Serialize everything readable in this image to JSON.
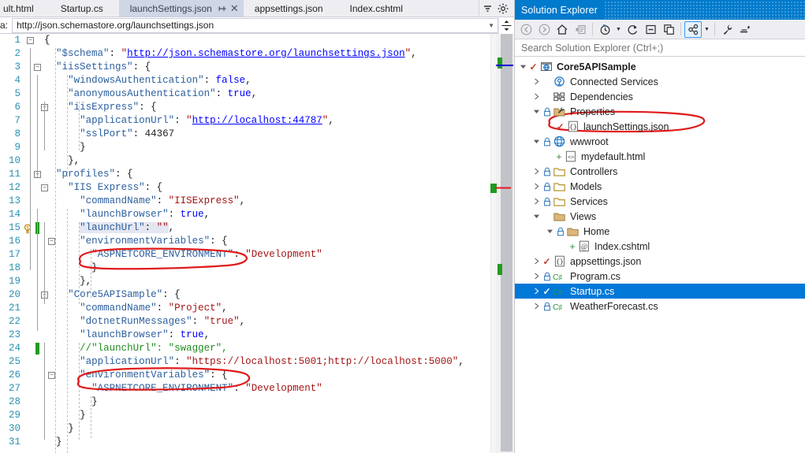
{
  "editor": {
    "tabs": [
      {
        "label": "ult.html",
        "state": "partial",
        "active": false
      },
      {
        "label": "Startup.cs",
        "state": "normal",
        "active": false
      },
      {
        "label": "launchSettings.json",
        "state": "normal",
        "active": true
      },
      {
        "label": "appsettings.json",
        "state": "normal",
        "active": false
      },
      {
        "label": "Index.cshtml",
        "state": "normal",
        "active": false
      }
    ],
    "tab_pin_icon": "pin-icon",
    "tab_close_icon": "close-icon",
    "tabstrip_overflow_icon": "chevron-down-icon",
    "tabstrip_settings_icon": "gear-icon",
    "nav": {
      "label": "a:",
      "value": "http://json.schemastore.org/launchsettings.json",
      "dropdown_icon": "chevron-down-icon",
      "split_icon": "split-view-icon"
    },
    "lines": [
      {
        "n": 1,
        "indent": 0,
        "outline": true,
        "text": "{"
      },
      {
        "n": 2,
        "indent": 1,
        "outline": false,
        "tokens": [
          {
            "t": "\"$schema\"",
            "c": "key"
          },
          {
            "t": ": ",
            "c": "punc"
          },
          {
            "t": "\"",
            "c": "str"
          },
          {
            "t": "http://json.schemastore.org/launchsettings.json",
            "c": "url"
          },
          {
            "t": "\"",
            "c": "str"
          },
          {
            "t": ",",
            "c": "punc"
          }
        ]
      },
      {
        "n": 3,
        "indent": 1,
        "outline": true,
        "tokens": [
          {
            "t": "\"iisSettings\"",
            "c": "key"
          },
          {
            "t": ": {",
            "c": "punc"
          }
        ]
      },
      {
        "n": 4,
        "indent": 2,
        "outline": false,
        "tokens": [
          {
            "t": "\"windowsAuthentication\"",
            "c": "key"
          },
          {
            "t": ": ",
            "c": "punc"
          },
          {
            "t": "false",
            "c": "bool"
          },
          {
            "t": ",",
            "c": "punc"
          }
        ]
      },
      {
        "n": 5,
        "indent": 2,
        "outline": false,
        "tokens": [
          {
            "t": "\"anonymousAuthentication\"",
            "c": "key"
          },
          {
            "t": ": ",
            "c": "punc"
          },
          {
            "t": "true",
            "c": "bool"
          },
          {
            "t": ",",
            "c": "punc"
          }
        ]
      },
      {
        "n": 6,
        "indent": 2,
        "outline": true,
        "tokens": [
          {
            "t": "\"iisExpress\"",
            "c": "key"
          },
          {
            "t": ": {",
            "c": "punc"
          }
        ]
      },
      {
        "n": 7,
        "indent": 3,
        "outline": false,
        "tokens": [
          {
            "t": "\"applicationUrl\"",
            "c": "key"
          },
          {
            "t": ": ",
            "c": "punc"
          },
          {
            "t": "\"",
            "c": "str"
          },
          {
            "t": "http://localhost:44787",
            "c": "url"
          },
          {
            "t": "\"",
            "c": "str"
          },
          {
            "t": ",",
            "c": "punc"
          }
        ]
      },
      {
        "n": 8,
        "indent": 3,
        "outline": false,
        "tokens": [
          {
            "t": "\"sslPort\"",
            "c": "key"
          },
          {
            "t": ": ",
            "c": "punc"
          },
          {
            "t": "44367",
            "c": "num"
          }
        ]
      },
      {
        "n": 9,
        "indent": 3,
        "outline": false,
        "text": "}"
      },
      {
        "n": 10,
        "indent": 2,
        "outline": false,
        "text": "},"
      },
      {
        "n": 11,
        "indent": 1,
        "outline": true,
        "tokens": [
          {
            "t": "\"profiles\"",
            "c": "key"
          },
          {
            "t": ": {",
            "c": "punc"
          }
        ]
      },
      {
        "n": 12,
        "indent": 2,
        "outline": true,
        "tokens": [
          {
            "t": "\"IIS Express\"",
            "c": "key"
          },
          {
            "t": ": {",
            "c": "punc"
          }
        ]
      },
      {
        "n": 13,
        "indent": 3,
        "outline": false,
        "tokens": [
          {
            "t": "\"commandName\"",
            "c": "key"
          },
          {
            "t": ": ",
            "c": "punc"
          },
          {
            "t": "\"IISExpress\"",
            "c": "str"
          },
          {
            "t": ",",
            "c": "punc"
          }
        ]
      },
      {
        "n": 14,
        "indent": 3,
        "outline": false,
        "tokens": [
          {
            "t": "\"launchBrowser\"",
            "c": "key"
          },
          {
            "t": ": ",
            "c": "punc"
          },
          {
            "t": "true",
            "c": "bool"
          },
          {
            "t": ",",
            "c": "punc"
          }
        ]
      },
      {
        "n": 15,
        "indent": 3,
        "outline": false,
        "lightbulb": true,
        "changebar": true,
        "highlight": true,
        "tokens": [
          {
            "t": "\"launchUrl\"",
            "c": "key"
          },
          {
            "t": ": ",
            "c": "punc"
          },
          {
            "t": "\"\"",
            "c": "str"
          },
          {
            "t": ",",
            "c": "punc"
          }
        ]
      },
      {
        "n": 16,
        "indent": 3,
        "outline": true,
        "tokens": [
          {
            "t": "\"environmentVariables\"",
            "c": "key"
          },
          {
            "t": ": {",
            "c": "punc"
          }
        ]
      },
      {
        "n": 17,
        "indent": 4,
        "outline": false,
        "tokens": [
          {
            "t": "\"ASPNETCORE_ENVIRONMENT\"",
            "c": "key"
          },
          {
            "t": ": ",
            "c": "punc"
          },
          {
            "t": "\"Development\"",
            "c": "str"
          }
        ]
      },
      {
        "n": 18,
        "indent": 4,
        "outline": false,
        "text": "}"
      },
      {
        "n": 19,
        "indent": 3,
        "outline": false,
        "text": "},"
      },
      {
        "n": 20,
        "indent": 2,
        "outline": true,
        "tokens": [
          {
            "t": "\"Core5APISample\"",
            "c": "key"
          },
          {
            "t": ": {",
            "c": "punc"
          }
        ]
      },
      {
        "n": 21,
        "indent": 3,
        "outline": false,
        "tokens": [
          {
            "t": "\"commandName\"",
            "c": "key"
          },
          {
            "t": ": ",
            "c": "punc"
          },
          {
            "t": "\"Project\"",
            "c": "str"
          },
          {
            "t": ",",
            "c": "punc"
          }
        ]
      },
      {
        "n": 22,
        "indent": 3,
        "outline": false,
        "tokens": [
          {
            "t": "\"dotnetRunMessages\"",
            "c": "key"
          },
          {
            "t": ": ",
            "c": "punc"
          },
          {
            "t": "\"true\"",
            "c": "str"
          },
          {
            "t": ",",
            "c": "punc"
          }
        ]
      },
      {
        "n": 23,
        "indent": 3,
        "outline": false,
        "tokens": [
          {
            "t": "\"launchBrowser\"",
            "c": "key"
          },
          {
            "t": ": ",
            "c": "punc"
          },
          {
            "t": "true",
            "c": "bool"
          },
          {
            "t": ",",
            "c": "punc"
          }
        ]
      },
      {
        "n": 24,
        "indent": 3,
        "outline": false,
        "changebar": true,
        "tokens": [
          {
            "t": "//\"launchUrl\": \"swagger\",",
            "c": "cmt"
          }
        ]
      },
      {
        "n": 25,
        "indent": 3,
        "outline": false,
        "tokens": [
          {
            "t": "\"applicationUrl\"",
            "c": "key"
          },
          {
            "t": ": ",
            "c": "punc"
          },
          {
            "t": "\"https://localhost:5001;http://localhost:5000\"",
            "c": "str"
          },
          {
            "t": ",",
            "c": "punc"
          }
        ]
      },
      {
        "n": 26,
        "indent": 3,
        "outline": true,
        "tokens": [
          {
            "t": "\"environmentVariables\"",
            "c": "key"
          },
          {
            "t": ": {",
            "c": "punc"
          }
        ]
      },
      {
        "n": 27,
        "indent": 4,
        "outline": false,
        "tokens": [
          {
            "t": "\"ASPNETCORE_ENVIRONMENT\"",
            "c": "key"
          },
          {
            "t": ": ",
            "c": "punc"
          },
          {
            "t": "\"Development\"",
            "c": "str"
          }
        ]
      },
      {
        "n": 28,
        "indent": 4,
        "outline": false,
        "text": "}"
      },
      {
        "n": 29,
        "indent": 3,
        "outline": false,
        "text": "}"
      },
      {
        "n": 30,
        "indent": 2,
        "outline": false,
        "text": "}"
      },
      {
        "n": 31,
        "indent": 1,
        "outline": false,
        "text": "}"
      }
    ],
    "annotations": [
      {
        "name": "ink-ellipse-launchurl",
        "note": "red ellipse around launchUrl on line 15"
      },
      {
        "name": "ink-ellipse-swagger-comment",
        "note": "red ellipse around commented launchUrl swagger on line 24"
      }
    ],
    "colors": {
      "key": "#2b5f9e",
      "string": "#a31515",
      "boolean": "#0000ff",
      "comment": "#1f8b1f",
      "url": "#0000ff",
      "line_number": "#2b91af",
      "change_bar": "#1f9b1f",
      "ink": "#e01b1b"
    }
  },
  "solution_explorer": {
    "title": "Solution Explorer",
    "toolbar": [
      {
        "name": "back-icon",
        "glyph": "←",
        "disabled": true,
        "checked": false
      },
      {
        "name": "forward-icon",
        "glyph": "→",
        "disabled": true,
        "checked": false
      },
      {
        "name": "home-icon",
        "glyph": "⌂",
        "disabled": false,
        "checked": false
      },
      {
        "name": "pending-changes-icon",
        "glyph": "▤",
        "disabled": true,
        "checked": false
      },
      {
        "name": "sync-with-active-document-icon",
        "glyph": "◴",
        "disabled": false,
        "checked": false
      },
      {
        "name": "refresh-icon",
        "glyph": "⟳",
        "disabled": false,
        "checked": false
      },
      {
        "name": "collapse-all-icon",
        "glyph": "⊟",
        "disabled": false,
        "checked": false
      },
      {
        "name": "show-all-files-icon",
        "glyph": "⧉",
        "disabled": false,
        "checked": false
      },
      {
        "name": "view-code-icon",
        "glyph": "⚭",
        "disabled": false,
        "checked": true
      },
      {
        "name": "properties-icon",
        "glyph": "ὒ7",
        "disabled": false,
        "checked": false
      },
      {
        "name": "preview-selected-items-icon",
        "glyph": "≡",
        "disabled": false,
        "checked": false
      }
    ],
    "search_placeholder": "Search Solution Explorer (Ctrl+;)",
    "tree": [
      {
        "label": "Core5APISample",
        "depth": 0,
        "expander": "expanded",
        "check": true,
        "lock": false,
        "icon": "solution-project-icon",
        "bold": true
      },
      {
        "label": "Connected Services",
        "depth": 1,
        "expander": "collapsed",
        "check": false,
        "lock": false,
        "icon": "connected-services-icon"
      },
      {
        "label": "Dependencies",
        "depth": 1,
        "expander": "collapsed",
        "check": false,
        "lock": false,
        "icon": "dependencies-icon"
      },
      {
        "label": "Properties",
        "depth": 1,
        "expander": "expanded",
        "check": false,
        "lock": true,
        "icon": "properties-folder-icon"
      },
      {
        "label": "launchSettings.json",
        "depth": 2,
        "expander": "none",
        "check": true,
        "lock": false,
        "icon": "json-file-icon"
      },
      {
        "label": "wwwroot",
        "depth": 1,
        "expander": "expanded",
        "check": false,
        "lock": true,
        "icon": "wwwroot-globe-icon"
      },
      {
        "label": "mydefault.html",
        "depth": 2,
        "expander": "none",
        "check": false,
        "lock": false,
        "icon": "html-file-icon",
        "plus": true
      },
      {
        "label": "Controllers",
        "depth": 1,
        "expander": "collapsed",
        "check": false,
        "lock": true,
        "icon": "folder-icon"
      },
      {
        "label": "Models",
        "depth": 1,
        "expander": "collapsed",
        "check": false,
        "lock": true,
        "icon": "folder-icon"
      },
      {
        "label": "Services",
        "depth": 1,
        "expander": "collapsed",
        "check": false,
        "lock": true,
        "icon": "folder-icon"
      },
      {
        "label": "Views",
        "depth": 1,
        "expander": "expanded",
        "check": false,
        "lock": false,
        "icon": "folder-open-icon"
      },
      {
        "label": "Home",
        "depth": 2,
        "expander": "expanded",
        "check": false,
        "lock": true,
        "icon": "folder-open-icon"
      },
      {
        "label": "Index.cshtml",
        "depth": 3,
        "expander": "none",
        "check": false,
        "lock": false,
        "icon": "cshtml-file-icon",
        "plus": true
      },
      {
        "label": "appsettings.json",
        "depth": 1,
        "expander": "collapsed",
        "check": true,
        "lock": false,
        "icon": "json-file-icon"
      },
      {
        "label": "Program.cs",
        "depth": 1,
        "expander": "collapsed",
        "check": false,
        "lock": true,
        "icon": "csharp-file-icon"
      },
      {
        "label": "Startup.cs",
        "depth": 1,
        "expander": "collapsed",
        "check": true,
        "lock": false,
        "icon": "csharp-file-icon",
        "selected": true
      },
      {
        "label": "WeatherForecast.cs",
        "depth": 1,
        "expander": "collapsed",
        "check": false,
        "lock": true,
        "icon": "csharp-file-icon"
      }
    ],
    "annotations": [
      {
        "name": "ink-ellipse-launchsettings",
        "note": "red ellipse around launchSettings.json tree node"
      }
    ],
    "colors": {
      "title_bar": "#007acc",
      "selection": "#0078d7",
      "check": "#c0392b",
      "lock": "#3a7ebf",
      "folder": "#dcb67a"
    }
  }
}
